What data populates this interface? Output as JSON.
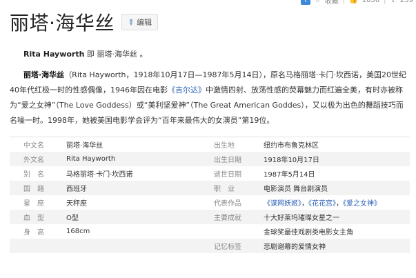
{
  "topbar": {
    "favorite_label": "收藏",
    "like_count": "1056",
    "share_count": "239"
  },
  "title": "丽塔·海华丝",
  "edit_label": "编辑",
  "summary": {
    "name_en": "Rita Hayworth",
    "text": "即 丽塔·海华丝 。"
  },
  "intro": {
    "name_bold": "丽塔·海华丝",
    "part1": "（Rita Hayworth，1918年10月17日—1987年5月14日），原名马格丽塔·卡门·坎西诺，美国20世纪40年代红极一时的性感偶像，1946年因在电影",
    "link": "《吉尔达》",
    "part2": "中激情四射、放荡性感的荧幕魅力而红遍全美，有时亦被称为“爱之女神”（The Love Goddess）或“美利坚爱神”（The Great American Goddes），又以极为出色的舞蹈技巧而名噪一时。1998年，她被美国电影学会评为“百年来最伟大的女演员”第19位。"
  },
  "info": {
    "rows": [
      {
        "l1": "中文名",
        "v1": "丽塔·海华丝",
        "l2": "出生地",
        "v2": "纽约市布鲁克林区"
      },
      {
        "l1": "外文名",
        "v1": "Rita Hayworth",
        "l2": "出生日期",
        "v2": "1918年10月17日"
      },
      {
        "l1": "别　名",
        "v1": "马格丽塔·卡门·坎西诺",
        "l2": "逝世日期",
        "v2": "1987年5月14日"
      },
      {
        "l1": "国　籍",
        "v1": "西班牙",
        "l2": "职　业",
        "v2": "电影演员 舞台剧演员"
      },
      {
        "l1": "星　座",
        "v1": "天秤座",
        "l2": "代表作品",
        "works": [
          "《谋网妖姬》",
          "《花花宫》",
          "《爱之女神》"
        ]
      },
      {
        "l1": "血　型",
        "v1": "O型",
        "l2": "主要成就",
        "v2": "十大好莱坞璀璨女星之一"
      },
      {
        "l1": "身　高",
        "v1": "168cm",
        "l2": "",
        "v2": "金球奖最佳戏剧类电影女主角"
      },
      {
        "l1": "",
        "v1": "",
        "l2": "记忆标签",
        "v2": "悲剧谢幕的爱情女神"
      }
    ]
  }
}
